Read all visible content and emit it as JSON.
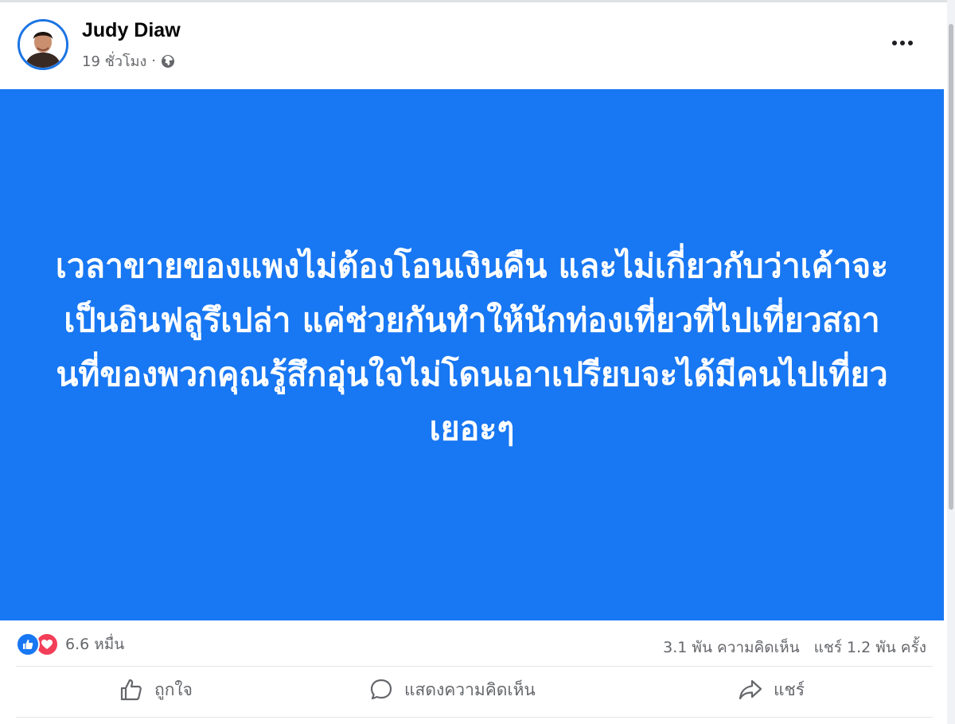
{
  "post": {
    "author": {
      "name": "Judy Diaw",
      "avatar_icon": "profile-photo"
    },
    "time_ago": "19 ชั่วโมง",
    "separator": "·",
    "privacy_icon": "globe-icon",
    "more_icon": "more-horizontal-icon",
    "background_color": "#1877f2",
    "text": "เวลาขายของแพงไม่ต้องโอนเงินคืน และไม่เกี่ยวกับว่าเค้าจะเป็นอินฟลูรึเปล่า แค่ช่วยกันทำให้นักท่องเที่ยวที่ไปเที่ยวสถานที่ของพวกคุณรู้สึกอุ่นใจไม่โดนเอาเปรียบจะได้มีคนไปเที่ยวเยอะๆ"
  },
  "stats": {
    "reaction_icons": [
      "like-reaction-icon",
      "love-reaction-icon"
    ],
    "reactions_count": "6.6 หมื่น",
    "comments": "3.1 พัน ความคิดเห็น",
    "shares": "แชร์ 1.2 พัน ครั้ง"
  },
  "actions": {
    "like_label": "ถูกใจ",
    "comment_label": "แสดงความคิดเห็น",
    "share_label": "แชร์"
  },
  "colors": {
    "accent": "#1877f2",
    "love": "#f33e58",
    "secondary_text": "#65676b"
  }
}
